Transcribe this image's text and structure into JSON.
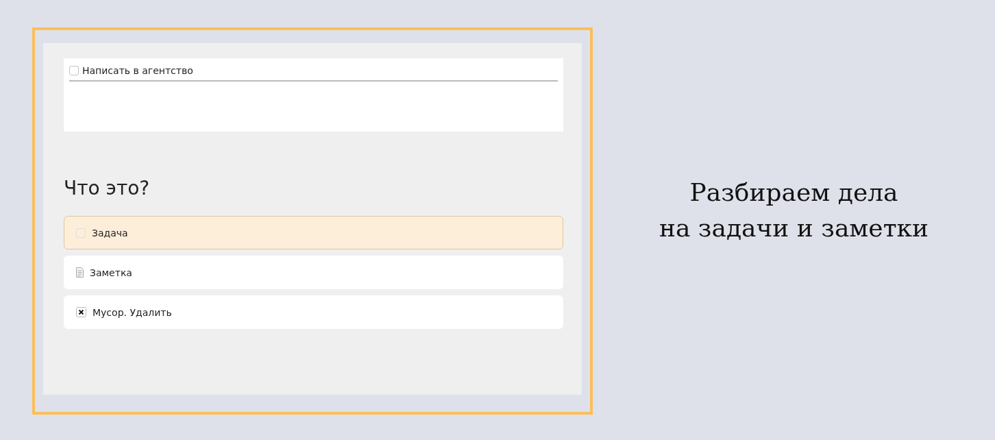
{
  "inbox_item": {
    "label": "Написать в агентство",
    "checked": false
  },
  "question": "Что это?",
  "options": [
    {
      "kind": "task",
      "label": "Задача",
      "selected": true
    },
    {
      "kind": "note",
      "label": "Заметка",
      "selected": false
    },
    {
      "kind": "trash",
      "label": "Мусор. Удалить",
      "selected": false
    }
  ],
  "caption": [
    "Разбираем дела",
    "на задачи и заметки"
  ]
}
